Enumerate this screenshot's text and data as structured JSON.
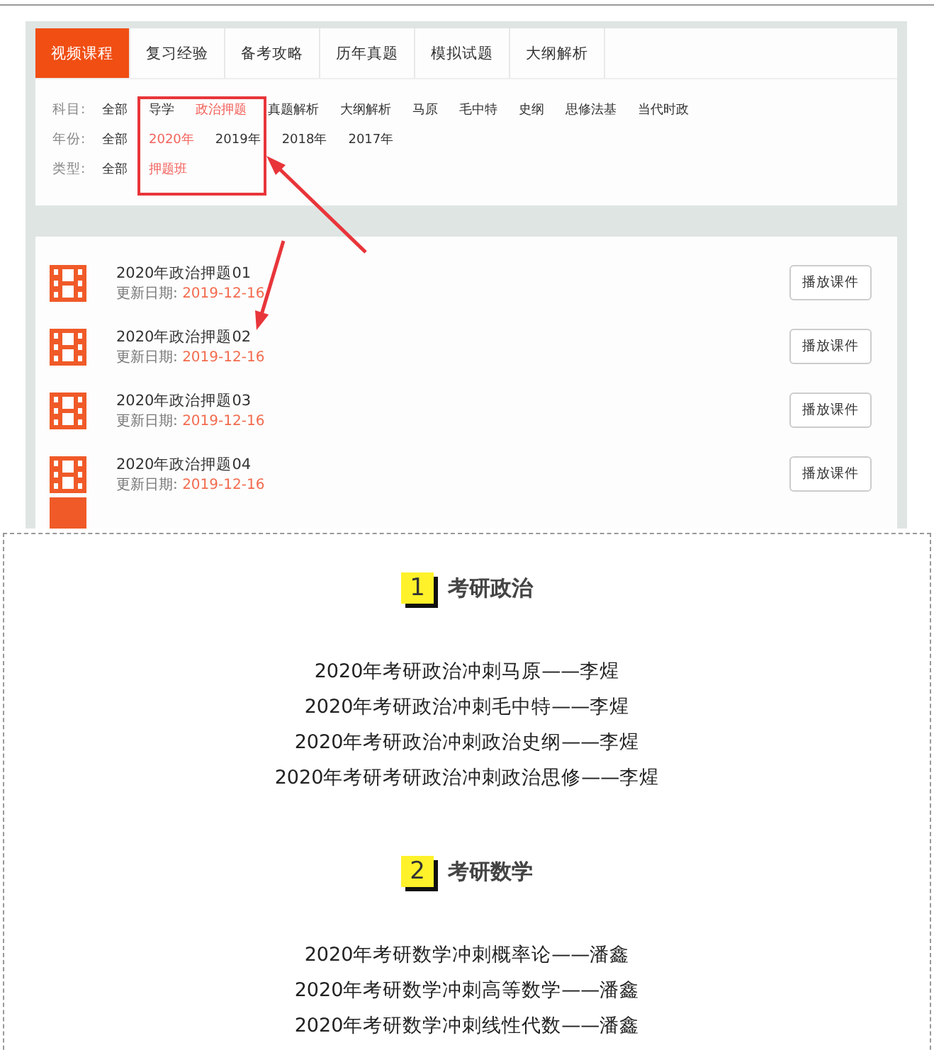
{
  "tabs": [
    {
      "label": "视频课程",
      "selected": true
    },
    {
      "label": "复习经验",
      "selected": false
    },
    {
      "label": "备考攻略",
      "selected": false
    },
    {
      "label": "历年真题",
      "selected": false
    },
    {
      "label": "模拟试题",
      "selected": false
    },
    {
      "label": "大纲解析",
      "selected": false
    }
  ],
  "filters": [
    {
      "label": "科目:",
      "options": [
        {
          "label": "全部",
          "selected": false
        },
        {
          "label": "导学",
          "selected": false
        },
        {
          "label": "政治押题",
          "selected": true
        },
        {
          "label": "真题解析",
          "selected": false
        },
        {
          "label": "大纲解析",
          "selected": false
        },
        {
          "label": "马原",
          "selected": false
        },
        {
          "label": "毛中特",
          "selected": false
        },
        {
          "label": "史纲",
          "selected": false
        },
        {
          "label": "思修法基",
          "selected": false
        },
        {
          "label": "当代时政",
          "selected": false
        }
      ]
    },
    {
      "label": "年份:",
      "options": [
        {
          "label": "全部",
          "selected": false
        },
        {
          "label": "2020年",
          "selected": true
        },
        {
          "label": "2019年",
          "selected": false
        },
        {
          "label": "2018年",
          "selected": false
        },
        {
          "label": "2017年",
          "selected": false
        }
      ]
    },
    {
      "label": "类型:",
      "options": [
        {
          "label": "全部",
          "selected": false
        },
        {
          "label": "押题班",
          "selected": true
        }
      ]
    }
  ],
  "courses": [
    {
      "title": "2020年政治押题01",
      "date_label": "更新日期:",
      "date": "2019-12-16",
      "button": "播放课件"
    },
    {
      "title": "2020年政治押题02",
      "date_label": "更新日期:",
      "date": "2019-12-16",
      "button": "播放课件"
    },
    {
      "title": "2020年政治押题03",
      "date_label": "更新日期:",
      "date": "2019-12-16",
      "button": "播放课件"
    },
    {
      "title": "2020年政治押题04",
      "date_label": "更新日期:",
      "date": "2019-12-16",
      "button": "播放课件"
    }
  ],
  "sections": [
    {
      "number": "1",
      "title": "考研政治",
      "items": [
        "2020年考研政治冲刺马原——李煋",
        "2020年考研政治冲刺毛中特——李煋",
        "2020年考研政治冲刺政治史纲——李煋",
        "2020年考研考研政治冲刺政治思修——李煋"
      ]
    },
    {
      "number": "2",
      "title": "考研数学",
      "items": [
        "2020年考研数学冲刺概率论——潘鑫",
        "2020年考研数学冲刺高等数学——潘鑫",
        "2020年考研数学冲刺线性代数——潘鑫"
      ]
    }
  ]
}
